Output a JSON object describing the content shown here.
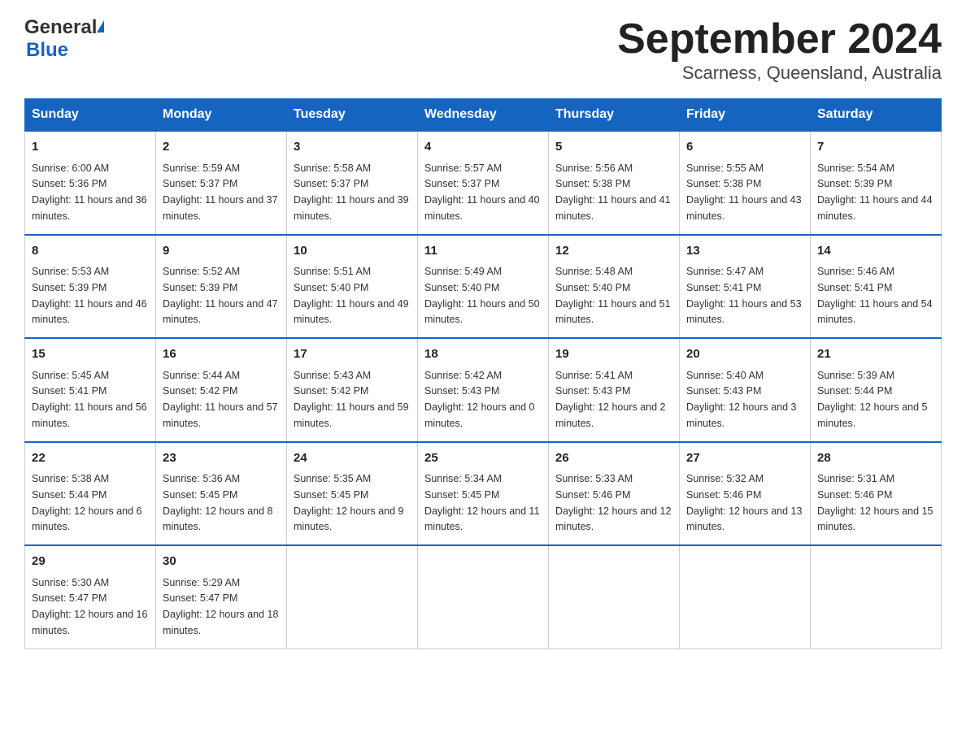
{
  "header": {
    "logo_general": "General",
    "logo_blue": "Blue",
    "title": "September 2024",
    "subtitle": "Scarness, Queensland, Australia"
  },
  "days_of_week": [
    "Sunday",
    "Monday",
    "Tuesday",
    "Wednesday",
    "Thursday",
    "Friday",
    "Saturday"
  ],
  "weeks": [
    [
      {
        "day": "1",
        "sunrise": "6:00 AM",
        "sunset": "5:36 PM",
        "daylight": "11 hours and 36 minutes."
      },
      {
        "day": "2",
        "sunrise": "5:59 AM",
        "sunset": "5:37 PM",
        "daylight": "11 hours and 37 minutes."
      },
      {
        "day": "3",
        "sunrise": "5:58 AM",
        "sunset": "5:37 PM",
        "daylight": "11 hours and 39 minutes."
      },
      {
        "day": "4",
        "sunrise": "5:57 AM",
        "sunset": "5:37 PM",
        "daylight": "11 hours and 40 minutes."
      },
      {
        "day": "5",
        "sunrise": "5:56 AM",
        "sunset": "5:38 PM",
        "daylight": "11 hours and 41 minutes."
      },
      {
        "day": "6",
        "sunrise": "5:55 AM",
        "sunset": "5:38 PM",
        "daylight": "11 hours and 43 minutes."
      },
      {
        "day": "7",
        "sunrise": "5:54 AM",
        "sunset": "5:39 PM",
        "daylight": "11 hours and 44 minutes."
      }
    ],
    [
      {
        "day": "8",
        "sunrise": "5:53 AM",
        "sunset": "5:39 PM",
        "daylight": "11 hours and 46 minutes."
      },
      {
        "day": "9",
        "sunrise": "5:52 AM",
        "sunset": "5:39 PM",
        "daylight": "11 hours and 47 minutes."
      },
      {
        "day": "10",
        "sunrise": "5:51 AM",
        "sunset": "5:40 PM",
        "daylight": "11 hours and 49 minutes."
      },
      {
        "day": "11",
        "sunrise": "5:49 AM",
        "sunset": "5:40 PM",
        "daylight": "11 hours and 50 minutes."
      },
      {
        "day": "12",
        "sunrise": "5:48 AM",
        "sunset": "5:40 PM",
        "daylight": "11 hours and 51 minutes."
      },
      {
        "day": "13",
        "sunrise": "5:47 AM",
        "sunset": "5:41 PM",
        "daylight": "11 hours and 53 minutes."
      },
      {
        "day": "14",
        "sunrise": "5:46 AM",
        "sunset": "5:41 PM",
        "daylight": "11 hours and 54 minutes."
      }
    ],
    [
      {
        "day": "15",
        "sunrise": "5:45 AM",
        "sunset": "5:41 PM",
        "daylight": "11 hours and 56 minutes."
      },
      {
        "day": "16",
        "sunrise": "5:44 AM",
        "sunset": "5:42 PM",
        "daylight": "11 hours and 57 minutes."
      },
      {
        "day": "17",
        "sunrise": "5:43 AM",
        "sunset": "5:42 PM",
        "daylight": "11 hours and 59 minutes."
      },
      {
        "day": "18",
        "sunrise": "5:42 AM",
        "sunset": "5:43 PM",
        "daylight": "12 hours and 0 minutes."
      },
      {
        "day": "19",
        "sunrise": "5:41 AM",
        "sunset": "5:43 PM",
        "daylight": "12 hours and 2 minutes."
      },
      {
        "day": "20",
        "sunrise": "5:40 AM",
        "sunset": "5:43 PM",
        "daylight": "12 hours and 3 minutes."
      },
      {
        "day": "21",
        "sunrise": "5:39 AM",
        "sunset": "5:44 PM",
        "daylight": "12 hours and 5 minutes."
      }
    ],
    [
      {
        "day": "22",
        "sunrise": "5:38 AM",
        "sunset": "5:44 PM",
        "daylight": "12 hours and 6 minutes."
      },
      {
        "day": "23",
        "sunrise": "5:36 AM",
        "sunset": "5:45 PM",
        "daylight": "12 hours and 8 minutes."
      },
      {
        "day": "24",
        "sunrise": "5:35 AM",
        "sunset": "5:45 PM",
        "daylight": "12 hours and 9 minutes."
      },
      {
        "day": "25",
        "sunrise": "5:34 AM",
        "sunset": "5:45 PM",
        "daylight": "12 hours and 11 minutes."
      },
      {
        "day": "26",
        "sunrise": "5:33 AM",
        "sunset": "5:46 PM",
        "daylight": "12 hours and 12 minutes."
      },
      {
        "day": "27",
        "sunrise": "5:32 AM",
        "sunset": "5:46 PM",
        "daylight": "12 hours and 13 minutes."
      },
      {
        "day": "28",
        "sunrise": "5:31 AM",
        "sunset": "5:46 PM",
        "daylight": "12 hours and 15 minutes."
      }
    ],
    [
      {
        "day": "29",
        "sunrise": "5:30 AM",
        "sunset": "5:47 PM",
        "daylight": "12 hours and 16 minutes."
      },
      {
        "day": "30",
        "sunrise": "5:29 AM",
        "sunset": "5:47 PM",
        "daylight": "12 hours and 18 minutes."
      },
      null,
      null,
      null,
      null,
      null
    ]
  ]
}
